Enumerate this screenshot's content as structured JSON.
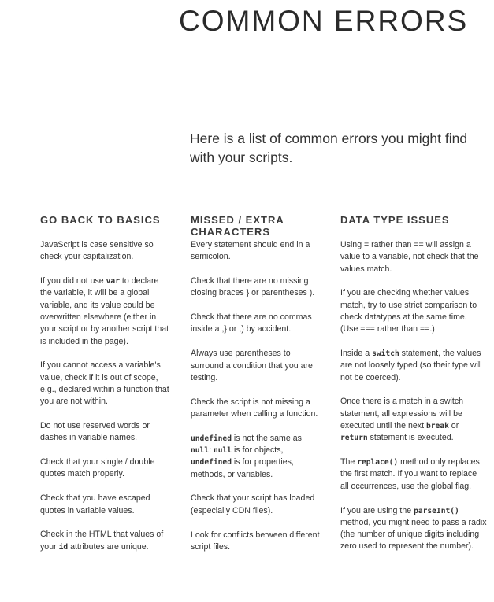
{
  "page": {
    "title": "COMMON ERRORS",
    "intro": "Here is a list of common errors you might find with your scripts."
  },
  "columns": [
    {
      "heading": "GO BACK TO BASICS",
      "items": [
        [
          {
            "t": "JavaScript is case sensitive so check your capitalization."
          }
        ],
        [
          {
            "t": "If you did not use "
          },
          {
            "c": "var"
          },
          {
            "t": " to declare the variable, it will be a global variable, and its value could be overwritten elsewhere (either in your script or by another script that is included in the page)."
          }
        ],
        [
          {
            "t": "If you cannot access a variable's value, check if it is out of scope, e.g., declared within a function that you are not within."
          }
        ],
        [
          {
            "t": "Do not use reserved words or dashes in variable names."
          }
        ],
        [
          {
            "t": "Check that your single / double quotes match properly."
          }
        ],
        [
          {
            "t": "Check that you have escaped quotes in variable values."
          }
        ],
        [
          {
            "t": "Check in the HTML that values of your "
          },
          {
            "c": "id"
          },
          {
            "t": " attributes are unique."
          }
        ]
      ]
    },
    {
      "heading": "MISSED / EXTRA CHARACTERS",
      "items": [
        [
          {
            "t": "Every statement should end in a semicolon."
          }
        ],
        [
          {
            "t": "Check that there are no missing closing braces } or parentheses )."
          }
        ],
        [
          {
            "t": "Check that there are no commas inside a ,} or ,) by accident."
          }
        ],
        [
          {
            "t": "Always use parentheses to surround a condition that you are testing."
          }
        ],
        [
          {
            "t": "Check the script is not missing a parameter when calling a function."
          }
        ],
        [
          {
            "c": "undefined"
          },
          {
            "t": " is not the same as "
          },
          {
            "c": "null"
          },
          {
            "t": ": "
          },
          {
            "c": "null"
          },
          {
            "t": " is for objects, "
          },
          {
            "c": "undefined"
          },
          {
            "t": " is for properties, methods, or variables."
          }
        ],
        [
          {
            "t": "Check that your script  has loaded (especially CDN files)."
          }
        ],
        [
          {
            "t": "Look for conflicts between different script files."
          }
        ]
      ]
    },
    {
      "heading": "DATA TYPE ISSUES",
      "items": [
        [
          {
            "t": "Using = rather than == will assign a value to a variable, not check that the values match."
          }
        ],
        [
          {
            "t": "If you are checking whether values match, try to use strict comparison to check datatypes at the same time. (Use === rather than ==.)"
          }
        ],
        [
          {
            "t": "Inside a "
          },
          {
            "c": "switch"
          },
          {
            "t": " statement, the values are not loosely typed (so their type will not be coerced)."
          }
        ],
        [
          {
            "t": "Once there is a match in a switch statement, all expressions will be executed until the next "
          },
          {
            "c": "break"
          },
          {
            "t": " or "
          },
          {
            "c": "return"
          },
          {
            "t": " statement is executed."
          }
        ],
        [
          {
            "t": "The "
          },
          {
            "c": "replace()"
          },
          {
            "t": " method only replaces the first match. If you want to replace all occurrences, use the global flag."
          }
        ],
        [
          {
            "t": "If you are using the "
          },
          {
            "c": "parseInt()"
          },
          {
            "t": " method, you might need to pass a radix (the number of unique digits including zero used to represent the number)."
          }
        ]
      ]
    }
  ]
}
